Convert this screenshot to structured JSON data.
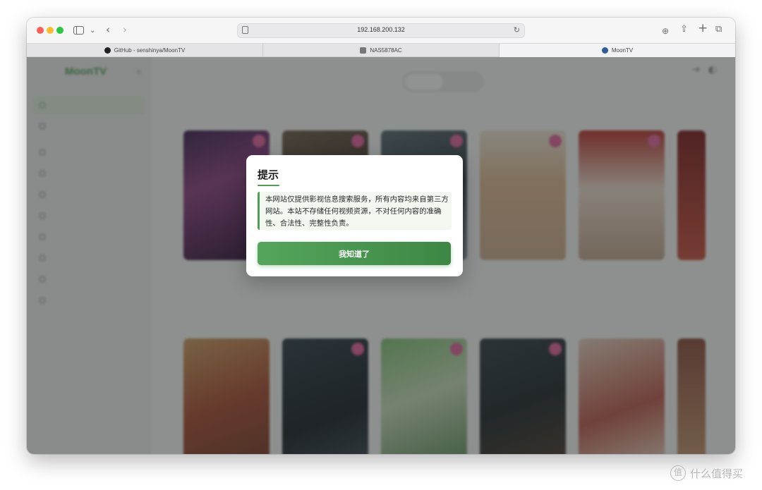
{
  "browser": {
    "url": "192.168.200.132",
    "tabs": [
      {
        "label": "GitHub - senshinya/MoonTV",
        "active": false
      },
      {
        "label": "NAS5878AC",
        "active": false
      },
      {
        "label": "MoonTV",
        "active": true
      }
    ]
  },
  "dialog": {
    "title": "提示",
    "message": "本网站仅提供影视信息搜索服务，所有内容均来自第三方网站。本站不存储任何视频资源，不对任何内容的准确性、合法性、完整性负责。",
    "confirm_label": "我知道了",
    "accent": "#4e9e55"
  },
  "app": {
    "logo": "MoonTV"
  },
  "watermark": {
    "text": "什么值得买",
    "logo_char": "值"
  }
}
